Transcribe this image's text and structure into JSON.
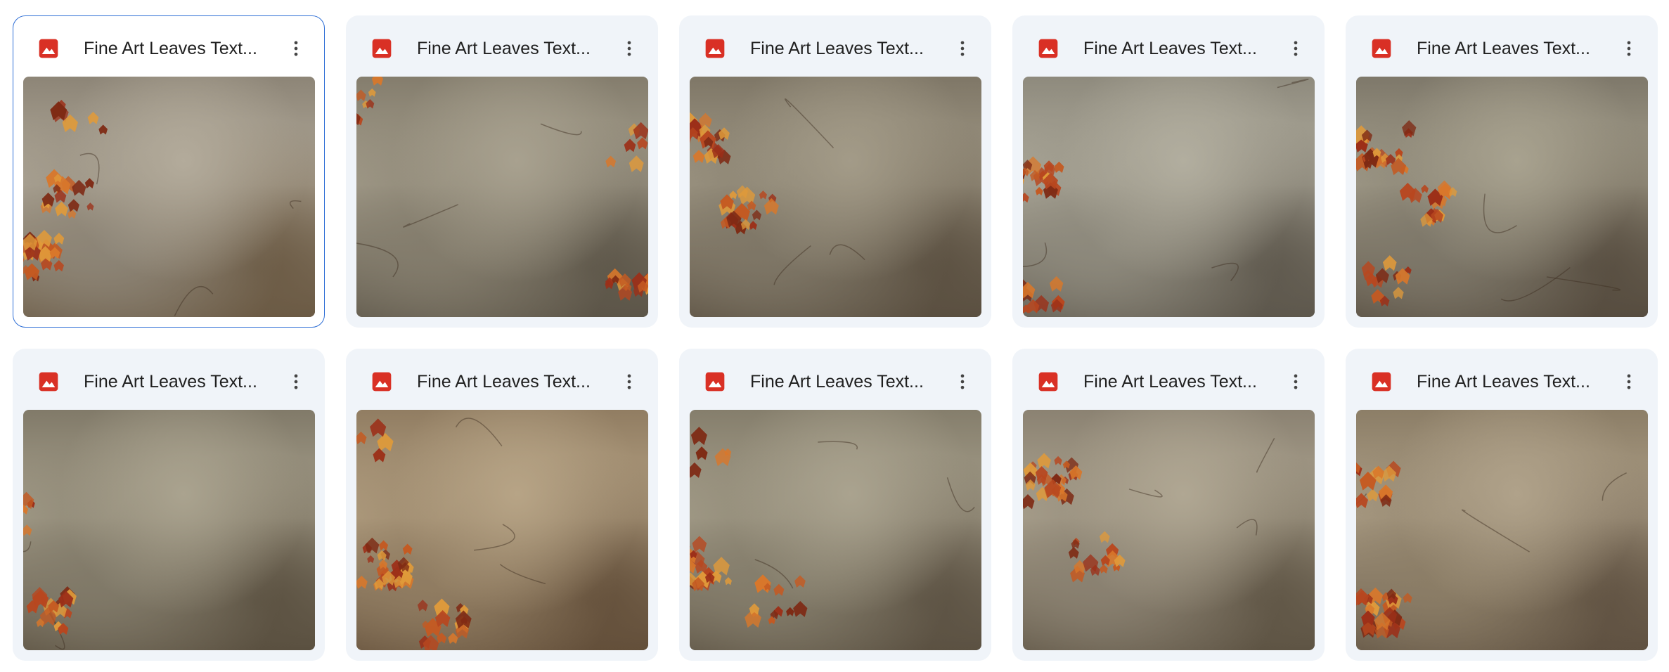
{
  "files": [
    {
      "name": "Fine Art Leaves Text...",
      "selected": true
    },
    {
      "name": "Fine Art Leaves Text...",
      "selected": false
    },
    {
      "name": "Fine Art Leaves Text...",
      "selected": false
    },
    {
      "name": "Fine Art Leaves Text...",
      "selected": false
    },
    {
      "name": "Fine Art Leaves Text...",
      "selected": false
    },
    {
      "name": "Fine Art Leaves Text...",
      "selected": false
    },
    {
      "name": "Fine Art Leaves Text...",
      "selected": false
    },
    {
      "name": "Fine Art Leaves Text...",
      "selected": false
    },
    {
      "name": "Fine Art Leaves Text...",
      "selected": false
    },
    {
      "name": "Fine Art Leaves Text...",
      "selected": false
    }
  ],
  "icons": {
    "file_type": "image-file-icon",
    "more": "more-vert-icon"
  },
  "colors": {
    "image_icon": "#d93025",
    "selection_border": "#2f6fd6",
    "card_background": "#f0f4f9",
    "text": "#1f1f1f"
  }
}
